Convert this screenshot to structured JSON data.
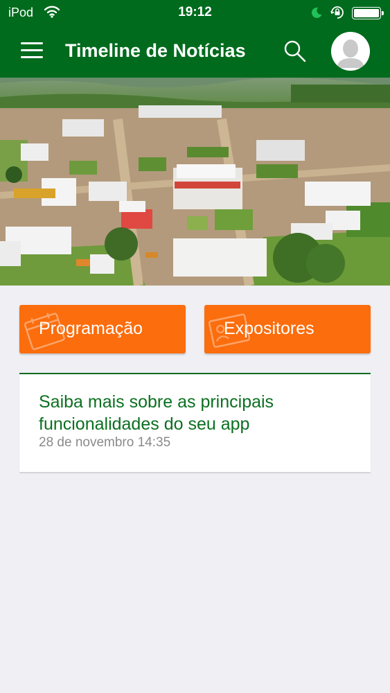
{
  "status_bar": {
    "carrier": "iPod",
    "time": "19:12",
    "icons": [
      "wifi-icon",
      "moon-icon",
      "orientation-lock-icon",
      "battery-icon"
    ]
  },
  "header": {
    "title": "Timeline de Notícias",
    "icons": [
      "menu-icon",
      "search-icon",
      "avatar-icon"
    ]
  },
  "actions": {
    "programacao_label": "Programação",
    "programacao_icon": "calendar-icon",
    "expositores_label": "Expositores",
    "expositores_icon": "id-card-icon"
  },
  "news": [
    {
      "title": "Saiba mais sobre as principais funcionalidades do seu app",
      "date": "28 de novembro 14:35"
    }
  ],
  "colors": {
    "header_green": "#006b1d",
    "accent_orange": "#fb6d0d",
    "news_title_green": "#0b7020",
    "background": "#efeff4"
  }
}
